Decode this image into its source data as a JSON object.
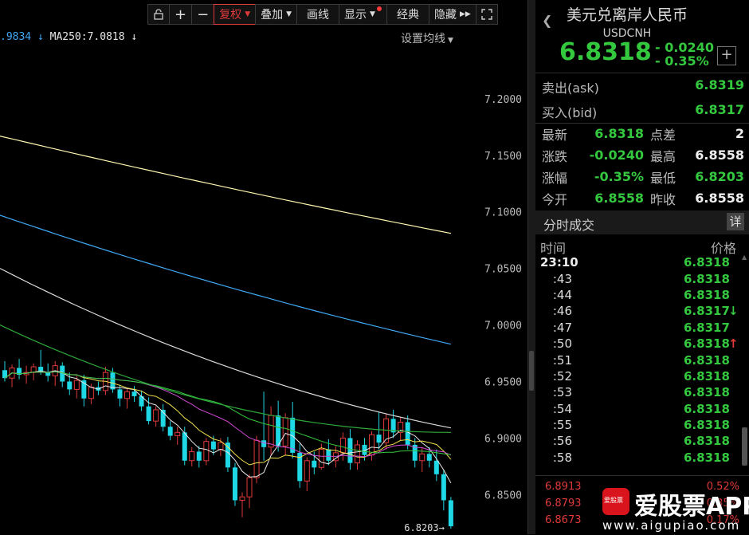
{
  "toolbar": {
    "items": [
      "复权",
      "叠加",
      "画线",
      "显示",
      "经典",
      "隐藏"
    ]
  },
  "ma_text": {
    "ma_prev": ".9834",
    "ma250": "MA250:7.0818",
    "arrow": "↓",
    "set_ma": "设置均线"
  },
  "chart_data": {
    "type": "candlestick",
    "y_axis_labels": [
      "7.2000",
      "7.1500",
      "7.1000",
      "7.0500",
      "7.0000",
      "6.9500",
      "6.9000",
      "6.8500"
    ],
    "ylim": [
      6.815,
      7.245
    ],
    "low_marker": "6.8203",
    "candles": [
      {
        "o": 6.96,
        "h": 6.968,
        "l": 6.95,
        "c": 6.953
      },
      {
        "o": 6.953,
        "h": 6.965,
        "l": 6.945,
        "c": 6.962
      },
      {
        "o": 6.962,
        "h": 6.97,
        "l": 6.952,
        "c": 6.956
      },
      {
        "o": 6.956,
        "h": 6.964,
        "l": 6.948,
        "c": 6.958
      },
      {
        "o": 6.958,
        "h": 6.966,
        "l": 6.951,
        "c": 6.963
      },
      {
        "o": 6.963,
        "h": 6.978,
        "l": 6.956,
        "c": 6.958
      },
      {
        "o": 6.958,
        "h": 6.966,
        "l": 6.95,
        "c": 6.955
      },
      {
        "o": 6.955,
        "h": 6.968,
        "l": 6.946,
        "c": 6.964
      },
      {
        "o": 6.964,
        "h": 6.967,
        "l": 6.945,
        "c": 6.95
      },
      {
        "o": 6.95,
        "h": 6.958,
        "l": 6.938,
        "c": 6.943
      },
      {
        "o": 6.943,
        "h": 6.955,
        "l": 6.935,
        "c": 6.951
      },
      {
        "o": 6.951,
        "h": 6.956,
        "l": 6.928,
        "c": 6.935
      },
      {
        "o": 6.935,
        "h": 6.948,
        "l": 6.93,
        "c": 6.945
      },
      {
        "o": 6.945,
        "h": 6.95,
        "l": 6.938,
        "c": 6.942
      },
      {
        "o": 6.942,
        "h": 6.963,
        "l": 6.938,
        "c": 6.958
      },
      {
        "o": 6.958,
        "h": 6.962,
        "l": 6.94,
        "c": 6.943
      },
      {
        "o": 6.943,
        "h": 6.947,
        "l": 6.928,
        "c": 6.935
      },
      {
        "o": 6.935,
        "h": 6.944,
        "l": 6.926,
        "c": 6.941
      },
      {
        "o": 6.941,
        "h": 6.946,
        "l": 6.932,
        "c": 6.937
      },
      {
        "o": 6.937,
        "h": 6.942,
        "l": 6.924,
        "c": 6.928
      },
      {
        "o": 6.928,
        "h": 6.936,
        "l": 6.912,
        "c": 6.915
      },
      {
        "o": 6.915,
        "h": 6.928,
        "l": 6.91,
        "c": 6.925
      },
      {
        "o": 6.925,
        "h": 6.93,
        "l": 6.906,
        "c": 6.91
      },
      {
        "o": 6.91,
        "h": 6.915,
        "l": 6.898,
        "c": 6.902
      },
      {
        "o": 6.902,
        "h": 6.91,
        "l": 6.894,
        "c": 6.905
      },
      {
        "o": 6.905,
        "h": 6.91,
        "l": 6.876,
        "c": 6.88
      },
      {
        "o": 6.88,
        "h": 6.892,
        "l": 6.875,
        "c": 6.888
      },
      {
        "o": 6.888,
        "h": 6.893,
        "l": 6.874,
        "c": 6.88
      },
      {
        "o": 6.88,
        "h": 6.9,
        "l": 6.876,
        "c": 6.897
      },
      {
        "o": 6.897,
        "h": 6.902,
        "l": 6.885,
        "c": 6.89
      },
      {
        "o": 6.89,
        "h": 6.9,
        "l": 6.884,
        "c": 6.896
      },
      {
        "o": 6.896,
        "h": 6.901,
        "l": 6.87,
        "c": 6.874
      },
      {
        "o": 6.874,
        "h": 6.878,
        "l": 6.84,
        "c": 6.845
      },
      {
        "o": 6.845,
        "h": 6.852,
        "l": 6.83,
        "c": 6.848
      },
      {
        "o": 6.848,
        "h": 6.868,
        "l": 6.838,
        "c": 6.865
      },
      {
        "o": 6.865,
        "h": 6.902,
        "l": 6.86,
        "c": 6.898
      },
      {
        "o": 6.898,
        "h": 6.941,
        "l": 6.88,
        "c": 6.892
      },
      {
        "o": 6.892,
        "h": 6.928,
        "l": 6.885,
        "c": 6.92
      },
      {
        "o": 6.92,
        "h": 6.933,
        "l": 6.888,
        "c": 6.893
      },
      {
        "o": 6.893,
        "h": 6.922,
        "l": 6.885,
        "c": 6.918
      },
      {
        "o": 6.918,
        "h": 6.932,
        "l": 6.882,
        "c": 6.887
      },
      {
        "o": 6.887,
        "h": 6.895,
        "l": 6.856,
        "c": 6.862
      },
      {
        "o": 6.862,
        "h": 6.883,
        "l": 6.853,
        "c": 6.88
      },
      {
        "o": 6.88,
        "h": 6.888,
        "l": 6.868,
        "c": 6.874
      },
      {
        "o": 6.874,
        "h": 6.895,
        "l": 6.872,
        "c": 6.89
      },
      {
        "o": 6.89,
        "h": 6.899,
        "l": 6.876,
        "c": 6.88
      },
      {
        "o": 6.88,
        "h": 6.893,
        "l": 6.874,
        "c": 6.887
      },
      {
        "o": 6.887,
        "h": 6.905,
        "l": 6.88,
        "c": 6.9
      },
      {
        "o": 6.9,
        "h": 6.908,
        "l": 6.872,
        "c": 6.878
      },
      {
        "o": 6.878,
        "h": 6.898,
        "l": 6.872,
        "c": 6.894
      },
      {
        "o": 6.894,
        "h": 6.9,
        "l": 6.88,
        "c": 6.885
      },
      {
        "o": 6.885,
        "h": 6.906,
        "l": 6.88,
        "c": 6.903
      },
      {
        "o": 6.903,
        "h": 6.923,
        "l": 6.89,
        "c": 6.896
      },
      {
        "o": 6.896,
        "h": 6.922,
        "l": 6.89,
        "c": 6.917
      },
      {
        "o": 6.917,
        "h": 6.925,
        "l": 6.9,
        "c": 6.905
      },
      {
        "o": 6.905,
        "h": 6.918,
        "l": 6.898,
        "c": 6.914
      },
      {
        "o": 6.914,
        "h": 6.92,
        "l": 6.89,
        "c": 6.894
      },
      {
        "o": 6.894,
        "h": 6.9,
        "l": 6.874,
        "c": 6.88
      },
      {
        "o": 6.88,
        "h": 6.892,
        "l": 6.87,
        "c": 6.886
      },
      {
        "o": 6.886,
        "h": 6.892,
        "l": 6.874,
        "c": 6.88
      },
      {
        "o": 6.88,
        "h": 6.89,
        "l": 6.862,
        "c": 6.868
      },
      {
        "o": 6.868,
        "h": 6.872,
        "l": 6.836,
        "c": 6.845
      },
      {
        "o": 6.845,
        "h": 6.848,
        "l": 6.82,
        "c": 6.822
      }
    ]
  },
  "quote": {
    "title": "美元兑离岸人民币",
    "code": "USDCNH",
    "price": "6.8318",
    "change": "- 0.0240",
    "change_pct": "- 0.35%",
    "ask_label": "卖出(ask)",
    "ask": "6.8319",
    "bid_label": "买入(bid)",
    "bid": "6.8317"
  },
  "stats": [
    {
      "l": "最新",
      "v": "6.8318",
      "l2": "点差",
      "v2": "2",
      "v2_green": false
    },
    {
      "l": "涨跌",
      "v": "-0.0240",
      "l2": "最高",
      "v2": "6.8558",
      "v2_green": false
    },
    {
      "l": "涨幅",
      "v": "-0.35%",
      "l2": "最低",
      "v2": "6.8203",
      "v2_green": true
    },
    {
      "l": "今开",
      "v": "6.8558",
      "l2": "昨收",
      "v2": "6.8558",
      "v2_green": false
    }
  ],
  "ticks_header": {
    "title": "分时成交",
    "detail": "详",
    "col_time": "时间",
    "col_price": "价格"
  },
  "ticks": [
    {
      "t": "23:10",
      "p": "6.8318",
      "a": ""
    },
    {
      "t": ":43",
      "p": "6.8318",
      "a": ""
    },
    {
      "t": ":44",
      "p": "6.8318",
      "a": ""
    },
    {
      "t": ":46",
      "p": "6.8317",
      "a": "↓"
    },
    {
      "t": ":47",
      "p": "6.8317",
      "a": ""
    },
    {
      "t": ":50",
      "p": "6.8318",
      "a": "↑"
    },
    {
      "t": ":51",
      "p": "6.8318",
      "a": ""
    },
    {
      "t": ":52",
      "p": "6.8318",
      "a": ""
    },
    {
      "t": ":53",
      "p": "6.8318",
      "a": ""
    },
    {
      "t": ":54",
      "p": "6.8318",
      "a": ""
    },
    {
      "t": ":55",
      "p": "6.8318",
      "a": ""
    },
    {
      "t": ":56",
      "p": "6.8318",
      "a": ""
    },
    {
      "t": ":58",
      "p": "6.8318",
      "a": ""
    }
  ],
  "bottom_rows": [
    {
      "l": "6.8913",
      "r": "0.52%"
    },
    {
      "l": "6.8793",
      "r": "0.35%"
    },
    {
      "l": "6.8673",
      "r": "0.17%"
    }
  ],
  "watermark": {
    "logo": "爱股票",
    "name": "爱股票APP",
    "url": "www.aigupiao.com"
  },
  "colors": {
    "up": "#e03a3a",
    "down": "#1fd8e6",
    "green": "#34c83f"
  }
}
